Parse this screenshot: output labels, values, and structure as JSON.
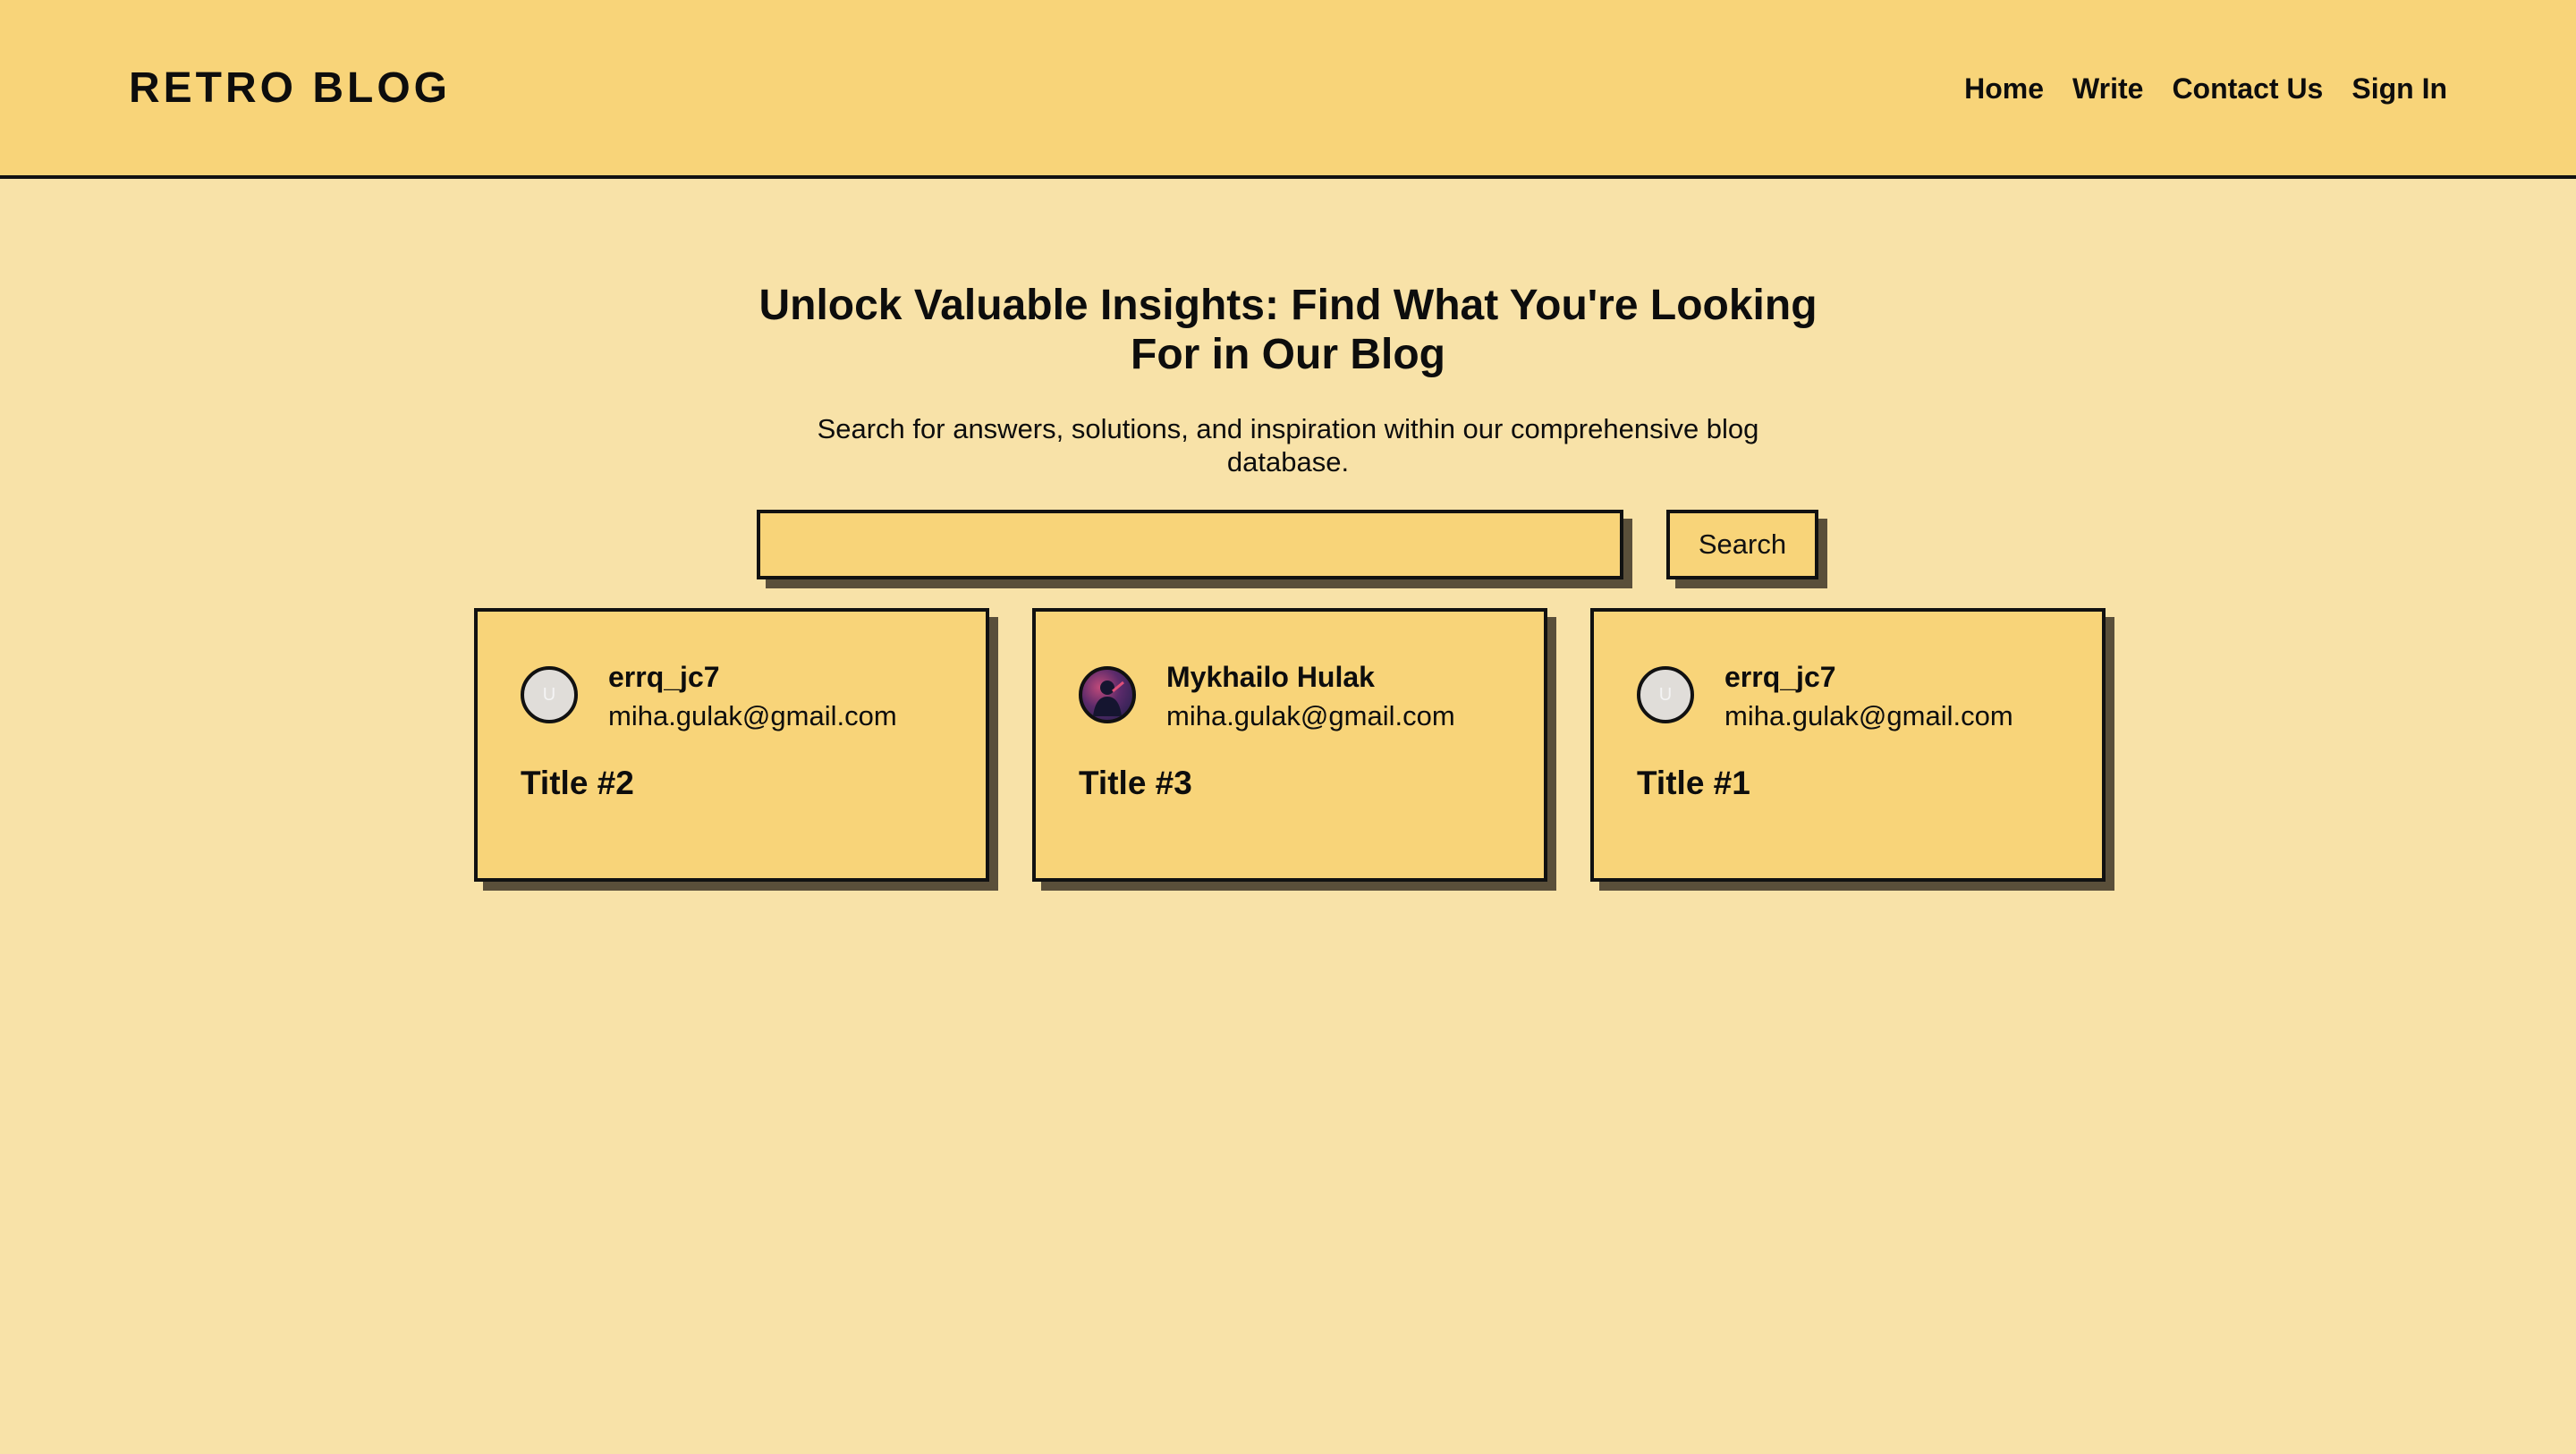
{
  "header": {
    "logo": "RETRO BLOG",
    "nav": [
      "Home",
      "Write",
      "Contact Us",
      "Sign In"
    ]
  },
  "hero": {
    "title": "Unlock Valuable Insights: Find What You're Looking For in Our Blog",
    "subtitle": "Search for answers, solutions, and inspiration within our comprehensive blog database."
  },
  "search": {
    "value": "",
    "placeholder": "",
    "button_label": "Search"
  },
  "posts": [
    {
      "author": "errq_jc7",
      "email": "miha.gulak@gmail.com",
      "title": "Title #2",
      "avatar": "U",
      "avatar_type": "placeholder-icon"
    },
    {
      "author": "Mykhailo Hulak",
      "email": "miha.gulak@gmail.com",
      "title": "Title #3",
      "avatar": "",
      "avatar_type": "photo"
    },
    {
      "author": "errq_jc7",
      "email": "miha.gulak@gmail.com",
      "title": "Title #1",
      "avatar": "U",
      "avatar_type": "placeholder-icon"
    }
  ],
  "colors": {
    "page_background": "#f8e2a8",
    "header_background": "#f8d479",
    "card_background": "#f8d479",
    "border": "#111111",
    "shadow": "#5a4f3a"
  }
}
